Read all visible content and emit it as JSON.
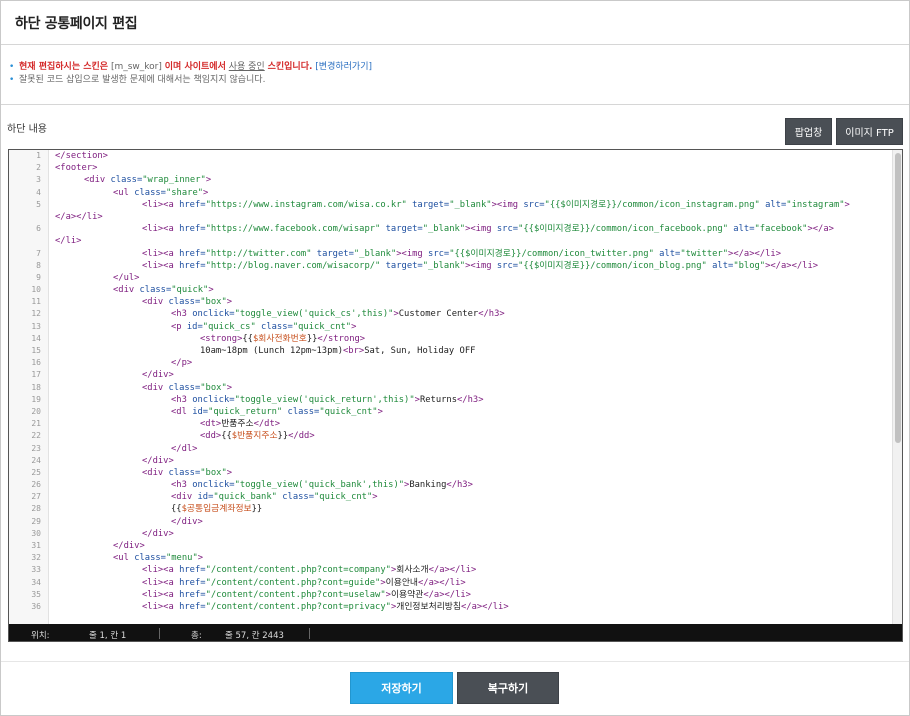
{
  "page": {
    "title": "하단 공통페이지 편집"
  },
  "notices": {
    "line1": {
      "prefix": "현재 편집하시는 스킨은",
      "skin": "[m_sw_kor]",
      "middle": "이며 사이트에서",
      "inuse": "사용 중인",
      "suffix": "스킨입니다.",
      "link": "[변경하러가기]"
    },
    "line2": "잘못된 코드 삽입으로 발생한 문제에 대해서는 책임지지 않습니다."
  },
  "section": {
    "label": "하단 내용"
  },
  "toolbar": {
    "popup_label": "팝업창",
    "ftp_label": "이미지 FTP"
  },
  "code": [
    {
      "n": "1",
      "ind": 0,
      "segs": [
        [
          "t",
          "</section>"
        ]
      ]
    },
    {
      "n": "2",
      "ind": 0,
      "segs": [
        [
          "t",
          "<footer>"
        ]
      ]
    },
    {
      "n": "3",
      "ind": 1,
      "segs": [
        [
          "t",
          "<div "
        ],
        [
          "a",
          "class="
        ],
        [
          "s",
          "\"wrap_inner\""
        ],
        [
          "t",
          ">"
        ]
      ]
    },
    {
      "n": "4",
      "ind": 2,
      "segs": [
        [
          "t",
          "<ul "
        ],
        [
          "a",
          "class="
        ],
        [
          "s",
          "\"share\""
        ],
        [
          "t",
          ">"
        ]
      ]
    },
    {
      "n": "5",
      "ind": 3,
      "segs": [
        [
          "t",
          "<li><a "
        ],
        [
          "a",
          "href="
        ],
        [
          "s",
          "\"https://www.instagram.com/wisa.co.kr\""
        ],
        [
          "a",
          " target="
        ],
        [
          "s",
          "\"_blank\""
        ],
        [
          "t",
          "><img "
        ],
        [
          "a",
          "src="
        ],
        [
          "s",
          "\"{{$이미지경로}}/common/icon_instagram.png\""
        ],
        [
          "a",
          " alt="
        ],
        [
          "s",
          "\"instagram\""
        ],
        [
          "t",
          ">"
        ]
      ]
    },
    {
      "n": "",
      "ind": 0,
      "segs": [
        [
          "t",
          "</a></li>"
        ]
      ]
    },
    {
      "n": "6",
      "ind": 3,
      "segs": [
        [
          "t",
          "<li><a "
        ],
        [
          "a",
          "href="
        ],
        [
          "s",
          "\"https://www.facebook.com/wisapr\""
        ],
        [
          "a",
          " target="
        ],
        [
          "s",
          "\"_blank\""
        ],
        [
          "t",
          "><img "
        ],
        [
          "a",
          "src="
        ],
        [
          "s",
          "\"{{$이미지경로}}/common/icon_facebook.png\""
        ],
        [
          "a",
          " alt="
        ],
        [
          "s",
          "\"facebook\""
        ],
        [
          "t",
          "></a>"
        ]
      ]
    },
    {
      "n": "",
      "ind": 0,
      "segs": [
        [
          "t",
          "</li>"
        ]
      ]
    },
    {
      "n": "7",
      "ind": 3,
      "segs": [
        [
          "t",
          "<li><a "
        ],
        [
          "a",
          "href="
        ],
        [
          "s",
          "\"http://twitter.com\""
        ],
        [
          "a",
          " target="
        ],
        [
          "s",
          "\"_blank\""
        ],
        [
          "t",
          "><img "
        ],
        [
          "a",
          "src="
        ],
        [
          "s",
          "\"{{$이미지경로}}/common/icon_twitter.png\""
        ],
        [
          "a",
          " alt="
        ],
        [
          "s",
          "\"twitter\""
        ],
        [
          "t",
          "></a></li>"
        ]
      ]
    },
    {
      "n": "8",
      "ind": 3,
      "segs": [
        [
          "t",
          "<li><a "
        ],
        [
          "a",
          "href="
        ],
        [
          "s",
          "\"http://blog.naver.com/wisacorp/\""
        ],
        [
          "a",
          " target="
        ],
        [
          "s",
          "\"_blank\""
        ],
        [
          "t",
          "><img "
        ],
        [
          "a",
          "src="
        ],
        [
          "s",
          "\"{{$이미지경로}}/common/icon_blog.png\""
        ],
        [
          "a",
          " alt="
        ],
        [
          "s",
          "\"blog\""
        ],
        [
          "t",
          "></a></li>"
        ]
      ]
    },
    {
      "n": "9",
      "ind": 2,
      "segs": [
        [
          "t",
          "</ul>"
        ]
      ]
    },
    {
      "n": "10",
      "ind": 2,
      "segs": [
        [
          "t",
          "<div "
        ],
        [
          "a",
          "class="
        ],
        [
          "s",
          "\"quick\""
        ],
        [
          "t",
          ">"
        ]
      ]
    },
    {
      "n": "11",
      "ind": 3,
      "segs": [
        [
          "t",
          "<div "
        ],
        [
          "a",
          "class="
        ],
        [
          "s",
          "\"box\""
        ],
        [
          "t",
          ">"
        ]
      ]
    },
    {
      "n": "12",
      "ind": 4,
      "segs": [
        [
          "t",
          "<h3 "
        ],
        [
          "a",
          "onclick="
        ],
        [
          "s",
          "\"toggle_view('quick_cs',this)\""
        ],
        [
          "t",
          ">"
        ],
        [
          "p",
          "Customer Center"
        ],
        [
          "t",
          "</h3>"
        ]
      ]
    },
    {
      "n": "13",
      "ind": 4,
      "segs": [
        [
          "t",
          "<p "
        ],
        [
          "a",
          "id="
        ],
        [
          "s",
          "\"quick_cs\""
        ],
        [
          "a",
          " class="
        ],
        [
          "s",
          "\"quick_cnt\""
        ],
        [
          "t",
          ">"
        ]
      ]
    },
    {
      "n": "14",
      "ind": 5,
      "segs": [
        [
          "t",
          "<strong>"
        ],
        [
          "p",
          "{{"
        ],
        [
          "v",
          "$회사전화번호"
        ],
        [
          "p",
          "}}"
        ],
        [
          "t",
          "</strong>"
        ]
      ]
    },
    {
      "n": "15",
      "ind": 5,
      "segs": [
        [
          "p",
          "10am~18pm (Lunch 12pm~13pm)"
        ],
        [
          "t",
          "<br>"
        ],
        [
          "p",
          "Sat, Sun, Holiday OFF"
        ]
      ]
    },
    {
      "n": "16",
      "ind": 4,
      "segs": [
        [
          "t",
          "</p>"
        ]
      ]
    },
    {
      "n": "17",
      "ind": 3,
      "segs": [
        [
          "t",
          "</div>"
        ]
      ]
    },
    {
      "n": "18",
      "ind": 3,
      "segs": [
        [
          "t",
          "<div "
        ],
        [
          "a",
          "class="
        ],
        [
          "s",
          "\"box\""
        ],
        [
          "t",
          ">"
        ]
      ]
    },
    {
      "n": "19",
      "ind": 4,
      "segs": [
        [
          "t",
          "<h3 "
        ],
        [
          "a",
          "onclick="
        ],
        [
          "s",
          "\"toggle_view('quick_return',this)\""
        ],
        [
          "t",
          ">"
        ],
        [
          "p",
          "Returns"
        ],
        [
          "t",
          "</h3>"
        ]
      ]
    },
    {
      "n": "20",
      "ind": 4,
      "segs": [
        [
          "t",
          "<dl "
        ],
        [
          "a",
          "id="
        ],
        [
          "s",
          "\"quick_return\""
        ],
        [
          "a",
          " class="
        ],
        [
          "s",
          "\"quick_cnt\""
        ],
        [
          "t",
          ">"
        ]
      ]
    },
    {
      "n": "21",
      "ind": 5,
      "segs": [
        [
          "t",
          "<dt>"
        ],
        [
          "p",
          "반품주소"
        ],
        [
          "t",
          "</dt>"
        ]
      ]
    },
    {
      "n": "22",
      "ind": 5,
      "segs": [
        [
          "t",
          "<dd>"
        ],
        [
          "p",
          "{{"
        ],
        [
          "v",
          "$반품지주소"
        ],
        [
          "p",
          "}}"
        ],
        [
          "t",
          "</dd>"
        ]
      ]
    },
    {
      "n": "23",
      "ind": 4,
      "segs": [
        [
          "t",
          "</dl>"
        ]
      ]
    },
    {
      "n": "24",
      "ind": 3,
      "segs": [
        [
          "t",
          "</div>"
        ]
      ]
    },
    {
      "n": "25",
      "ind": 3,
      "segs": [
        [
          "t",
          "<div "
        ],
        [
          "a",
          "class="
        ],
        [
          "s",
          "\"box\""
        ],
        [
          "t",
          ">"
        ]
      ]
    },
    {
      "n": "26",
      "ind": 4,
      "segs": [
        [
          "t",
          "<h3 "
        ],
        [
          "a",
          "onclick="
        ],
        [
          "s",
          "\"toggle_view('quick_bank',this)\""
        ],
        [
          "t",
          ">"
        ],
        [
          "p",
          "Banking"
        ],
        [
          "t",
          "</h3>"
        ]
      ]
    },
    {
      "n": "27",
      "ind": 4,
      "segs": [
        [
          "t",
          "<div "
        ],
        [
          "a",
          "id="
        ],
        [
          "s",
          "\"quick_bank\""
        ],
        [
          "a",
          " class="
        ],
        [
          "s",
          "\"quick_cnt\""
        ],
        [
          "t",
          ">"
        ]
      ]
    },
    {
      "n": "28",
      "ind": 4,
      "segs": [
        [
          "p",
          "{{"
        ],
        [
          "v",
          "$공통입금계좌정보"
        ],
        [
          "p",
          "}}"
        ]
      ]
    },
    {
      "n": "29",
      "ind": 4,
      "segs": [
        [
          "t",
          "</div>"
        ]
      ]
    },
    {
      "n": "30",
      "ind": 3,
      "segs": [
        [
          "t",
          "</div>"
        ]
      ]
    },
    {
      "n": "31",
      "ind": 2,
      "segs": [
        [
          "t",
          "</div>"
        ]
      ]
    },
    {
      "n": "32",
      "ind": 2,
      "segs": [
        [
          "t",
          "<ul "
        ],
        [
          "a",
          "class="
        ],
        [
          "s",
          "\"menu\""
        ],
        [
          "t",
          ">"
        ]
      ]
    },
    {
      "n": "33",
      "ind": 3,
      "segs": [
        [
          "t",
          "<li><a "
        ],
        [
          "a",
          "href="
        ],
        [
          "s",
          "\"/content/content.php?cont=company\""
        ],
        [
          "t",
          ">"
        ],
        [
          "p",
          "회사소개"
        ],
        [
          "t",
          "</a></li>"
        ]
      ]
    },
    {
      "n": "34",
      "ind": 3,
      "segs": [
        [
          "t",
          "<li><a "
        ],
        [
          "a",
          "href="
        ],
        [
          "s",
          "\"/content/content.php?cont=guide\""
        ],
        [
          "t",
          ">"
        ],
        [
          "p",
          "이용안내"
        ],
        [
          "t",
          "</a></li>"
        ]
      ]
    },
    {
      "n": "35",
      "ind": 3,
      "segs": [
        [
          "t",
          "<li><a "
        ],
        [
          "a",
          "href="
        ],
        [
          "s",
          "\"/content/content.php?cont=uselaw\""
        ],
        [
          "t",
          ">"
        ],
        [
          "p",
          "이용약관"
        ],
        [
          "t",
          "</a></li>"
        ]
      ]
    },
    {
      "n": "36",
      "ind": 3,
      "segs": [
        [
          "t",
          "<li><a "
        ],
        [
          "a",
          "href="
        ],
        [
          "s",
          "\"/content/content.php?cont=privacy\""
        ],
        [
          "t",
          ">"
        ],
        [
          "p",
          "개인정보처리방침"
        ],
        [
          "t",
          "</a></li>"
        ]
      ]
    }
  ],
  "status": {
    "pos_label": "위치:",
    "pos_value": "줄 1, 칸 1",
    "total_label": "총:",
    "total_value": "줄 57, 칸 2443"
  },
  "actions": {
    "save_label": "저장하기",
    "restore_label": "복구하기"
  },
  "colors": {
    "save": "#2ba7e6",
    "dark_button": "#4a4f55",
    "notice_red": "#d42a2a",
    "link_blue": "#2a6fc1",
    "tag": "#7d1b7e",
    "attr": "#1e4fa0",
    "string": "#1f8a3b",
    "variable": "#c7511f"
  }
}
